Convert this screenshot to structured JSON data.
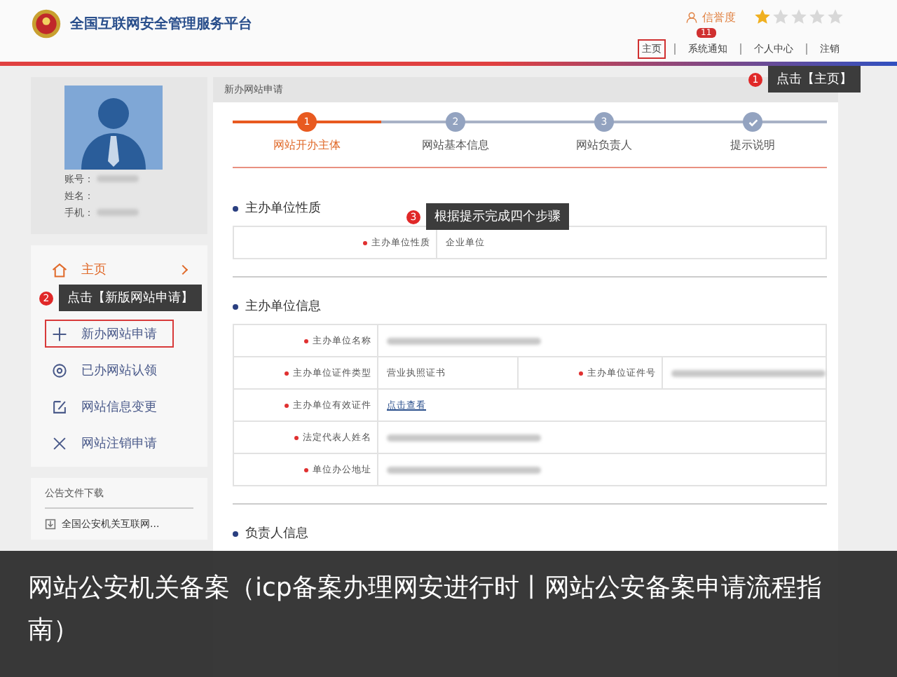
{
  "header": {
    "site_title": "全国互联网安全管理服务平台",
    "credit_label": "信誉度",
    "stars": 1,
    "nav": [
      {
        "label": "主页",
        "selected": true
      },
      {
        "label": "系统通知",
        "selected": false,
        "badge": "11"
      },
      {
        "label": "个人中心",
        "selected": false
      },
      {
        "label": "注销",
        "selected": false
      }
    ],
    "callout": {
      "number": "1",
      "text": "点击【主页】"
    }
  },
  "sidebar": {
    "profile": [
      {
        "label": "账号：",
        "masked": true
      },
      {
        "label": "姓名："
      },
      {
        "label": "手机：",
        "masked": true
      }
    ],
    "menu": [
      {
        "kind": "home",
        "label": "主页",
        "selected": true,
        "highlighted": false
      },
      {
        "kind": "plus",
        "label": "新办网站申请",
        "selected": false,
        "highlighted": true
      },
      {
        "kind": "at",
        "label": "已办网站认领",
        "selected": false,
        "highlighted": false
      },
      {
        "kind": "edit",
        "label": "网站信息变更",
        "selected": false,
        "highlighted": false
      },
      {
        "kind": "close",
        "label": "网站注销申请",
        "selected": false,
        "highlighted": false
      }
    ],
    "callout": {
      "number": "2",
      "text": "点击【新版网站申请】"
    },
    "downloads_title": "公告文件下载",
    "downloads": [
      "全国公安机关互联网..."
    ]
  },
  "main": {
    "breadcrumb": "新办网站申请",
    "steps": [
      {
        "kind": "number",
        "marker": "1",
        "label": "网站开办主体",
        "active": true
      },
      {
        "kind": "number",
        "marker": "2",
        "label": "网站基本信息",
        "active": false
      },
      {
        "kind": "number",
        "marker": "3",
        "label": "网站负责人",
        "active": false
      },
      {
        "kind": "check",
        "label": "提示说明",
        "active": false
      }
    ],
    "callout": {
      "number": "3",
      "text": "根据提示完成四个步骤"
    },
    "sections": [
      {
        "title": "主办单位性质",
        "rows": [
          [
            {
              "label": "主办单位性质",
              "required": true,
              "value": "企业单位"
            }
          ]
        ]
      },
      {
        "title": "主办单位信息",
        "rows": [
          [
            {
              "label": "主办单位名称",
              "required": true,
              "masked": true
            }
          ],
          [
            {
              "label": "主办单位证件类型",
              "required": true,
              "value": "营业执照证书"
            },
            {
              "label": "主办单位证件号",
              "required": true,
              "masked": true
            }
          ],
          [
            {
              "label": "主办单位有效证件",
              "required": true,
              "link": "点击查看"
            }
          ],
          [
            {
              "label": "法定代表人姓名",
              "required": true,
              "masked": true
            }
          ],
          [
            {
              "label": "单位办公地址",
              "required": true,
              "masked": true
            }
          ]
        ]
      },
      {
        "title": "负责人信息"
      }
    ]
  },
  "caption": "网站公安机关备案（icp备案办理网安进行时丨网站公安备案申请流程指南）"
}
